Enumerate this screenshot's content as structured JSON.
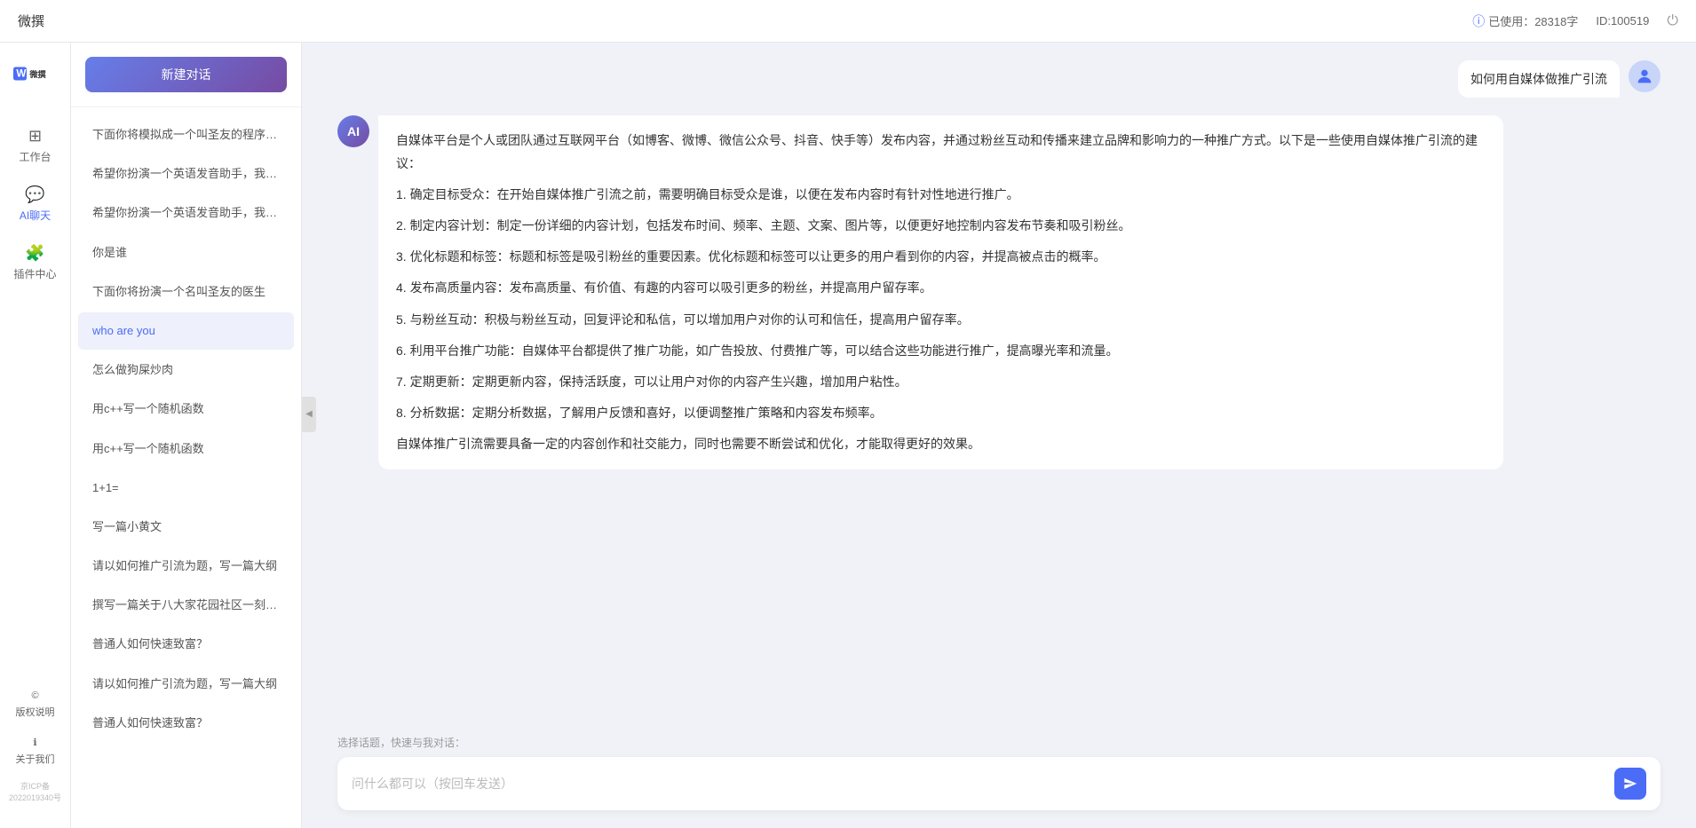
{
  "topbar": {
    "title": "微撰",
    "usage_label": "已使用：28318字",
    "id_label": "ID:100519",
    "usage_icon": "ⓘ"
  },
  "nav": {
    "logo_text": "W 微撰",
    "items": [
      {
        "id": "workbench",
        "icon": "⊞",
        "label": "工作台"
      },
      {
        "id": "ai-chat",
        "icon": "💬",
        "label": "AI聊天"
      },
      {
        "id": "plugin",
        "icon": "🧩",
        "label": "插件中心"
      }
    ],
    "bottom_items": [
      {
        "id": "copyright",
        "icon": "©",
        "label": "版权说明"
      },
      {
        "id": "about",
        "icon": "ℹ",
        "label": "关于我们"
      }
    ],
    "icp": "京ICP备2022019340号"
  },
  "sidebar": {
    "new_chat_label": "新建对话",
    "history": [
      {
        "id": "h1",
        "text": "下面你将模拟成一个叫圣友的程序员，我说...",
        "active": false
      },
      {
        "id": "h2",
        "text": "希望你扮演一个英语发音助手，我提供给你...",
        "active": false
      },
      {
        "id": "h3",
        "text": "希望你扮演一个英语发音助手，我提供给你...",
        "active": false
      },
      {
        "id": "h4",
        "text": "你是谁",
        "active": false
      },
      {
        "id": "h5",
        "text": "下面你将扮演一个名叫圣友的医生",
        "active": false
      },
      {
        "id": "h6",
        "text": "who are you",
        "active": true
      },
      {
        "id": "h7",
        "text": "怎么做狗屎炒肉",
        "active": false
      },
      {
        "id": "h8",
        "text": "用c++写一个随机函数",
        "active": false
      },
      {
        "id": "h9",
        "text": "用c++写一个随机函数",
        "active": false
      },
      {
        "id": "h10",
        "text": "1+1=",
        "active": false
      },
      {
        "id": "h11",
        "text": "写一篇小黄文",
        "active": false
      },
      {
        "id": "h12",
        "text": "请以如何推广引流为题，写一篇大纲",
        "active": false
      },
      {
        "id": "h13",
        "text": "撰写一篇关于八大家花园社区一刻钟便民生...",
        "active": false
      },
      {
        "id": "h14",
        "text": "普通人如何快速致富？",
        "active": false
      },
      {
        "id": "h15",
        "text": "请以如何推广引流为题，写一篇大纲",
        "active": false
      },
      {
        "id": "h16",
        "text": "普通人如何快速致富？",
        "active": false
      }
    ]
  },
  "chat": {
    "user_message": "如何用自媒体做推广引流",
    "ai_response": {
      "paragraphs": [
        "自媒体平台是个人或团队通过互联网平台（如博客、微博、微信公众号、抖音、快手等）发布内容，并通过粉丝互动和传播来建立品牌和影响力的一种推广方式。以下是一些使用自媒体推广引流的建议：",
        "1. 确定目标受众：在开始自媒体推广引流之前，需要明确目标受众是谁，以便在发布内容时有针对性地进行推广。",
        "2. 制定内容计划：制定一份详细的内容计划，包括发布时间、频率、主题、文案、图片等，以便更好地控制内容发布节奏和吸引粉丝。",
        "3. 优化标题和标签：标题和标签是吸引粉丝的重要因素。优化标题和标签可以让更多的用户看到你的内容，并提高被点击的概率。",
        "4. 发布高质量内容：发布高质量、有价值、有趣的内容可以吸引更多的粉丝，并提高用户留存率。",
        "5. 与粉丝互动：积极与粉丝互动，回复评论和私信，可以增加用户对你的认可和信任，提高用户留存率。",
        "6. 利用平台推广功能：自媒体平台都提供了推广功能，如广告投放、付费推广等，可以结合这些功能进行推广，提高曝光率和流量。",
        "7. 定期更新：定期更新内容，保持活跃度，可以让用户对你的内容产生兴趣，增加用户粘性。",
        "8. 分析数据：定期分析数据，了解用户反馈和喜好，以便调整推广策略和内容发布频率。",
        "自媒体推广引流需要具备一定的内容创作和社交能力，同时也需要不断尝试和优化，才能取得更好的效果。"
      ]
    },
    "quick_topics_label": "选择话题，快速与我对话：",
    "input_placeholder": "问什么都可以（按回车发送）"
  }
}
